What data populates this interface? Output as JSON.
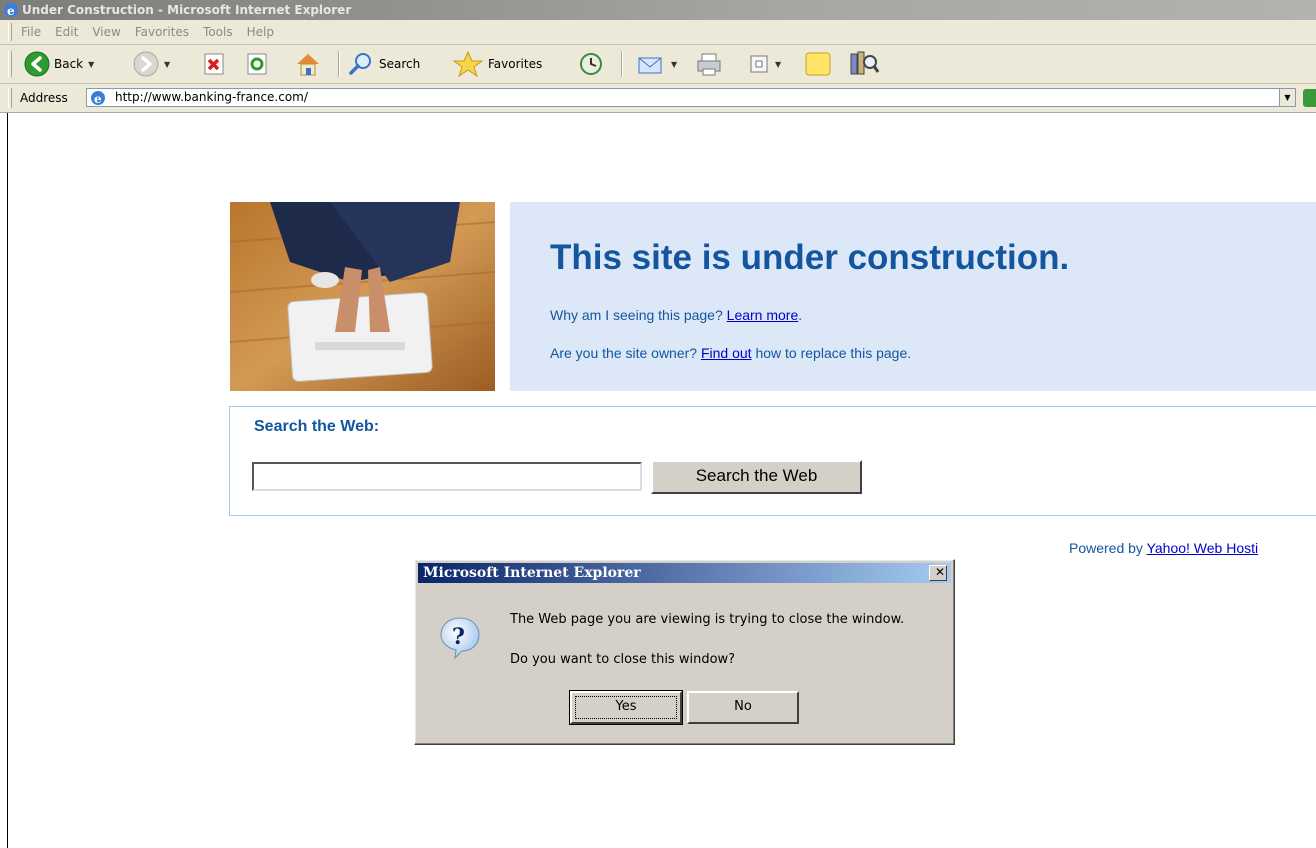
{
  "window": {
    "title": "Under Construction - Microsoft Internet Explorer"
  },
  "menu": [
    "File",
    "Edit",
    "View",
    "Favorites",
    "Tools",
    "Help"
  ],
  "toolbar": {
    "back": "Back",
    "search": "Search",
    "favorites": "Favorites"
  },
  "address": {
    "label": "Address",
    "url": "http://www.banking-france.com/"
  },
  "page": {
    "headline": "This site is under construction.",
    "why_text": "Why am I seeing this page? ",
    "why_link": "Learn more",
    "why_end": ".",
    "owner_text": "Are you the site owner? ",
    "owner_link": "Find out",
    "owner_end": " how to replace this page.",
    "search_title": "Search the Web:",
    "search_value": "",
    "search_button": "Search the Web",
    "powered_text": "Powered by ",
    "powered_link": "Yahoo! Web Hosti"
  },
  "dialog": {
    "title": "Microsoft Internet Explorer",
    "close_glyph": "✕",
    "message1": "The Web page you are viewing is trying to close the window.",
    "message2": "Do you want to close this window?",
    "yes": "Yes",
    "no": "No"
  }
}
